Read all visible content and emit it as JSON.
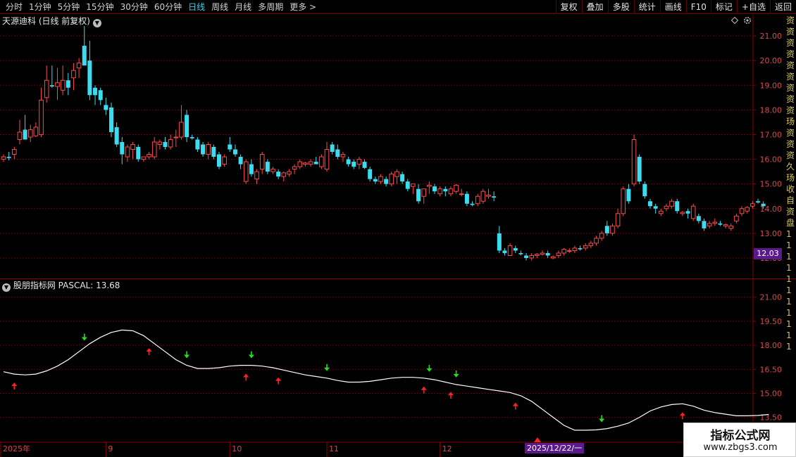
{
  "colors": {
    "up": "#ff4a4a",
    "down": "#3cdcf0",
    "grid": "#8a0000",
    "axis_text": "#d84a4a",
    "pascal_line": "#ffffff",
    "arrow_up": "#ff2020",
    "arrow_down": "#20e020",
    "date_tag_bg": "#5a1a8c"
  },
  "toolbar": {
    "periods": [
      {
        "label": "分时",
        "active": false
      },
      {
        "label": "1分钟",
        "active": false
      },
      {
        "label": "5分钟",
        "active": false
      },
      {
        "label": "15分钟",
        "active": false
      },
      {
        "label": "30分钟",
        "active": false
      },
      {
        "label": "60分钟",
        "active": false
      },
      {
        "label": "日线",
        "active": true
      },
      {
        "label": "周线",
        "active": false
      },
      {
        "label": "月线",
        "active": false
      },
      {
        "label": "多周期",
        "active": false
      },
      {
        "label": "更多 >",
        "active": false
      }
    ],
    "buttons": [
      "复权",
      "叠加",
      "多股",
      "统计",
      "画线",
      "F10",
      "标记",
      "+自选",
      "返回"
    ]
  },
  "main_chart": {
    "title": "天源迪科 (日线 前复权)",
    "price_tag": "12.03",
    "y_ticks": [
      "21.00",
      "20.00",
      "19.00",
      "18.00",
      "17.00",
      "16.00",
      "15.00",
      "14.00",
      "13.00",
      "12.00"
    ]
  },
  "sub_chart": {
    "title": "股朋指标网 PASCAL: 13.68",
    "y_ticks": [
      "21.00",
      "19.50",
      "18.00",
      "16.50",
      "15.00",
      "13.50"
    ]
  },
  "x_axis": {
    "labels": [
      "2025年",
      "9",
      "10",
      "11",
      "12"
    ],
    "date_tag": "2025/12/22/一"
  },
  "right_strip": [
    "资",
    "资",
    "资",
    "资",
    "资",
    "资",
    "资",
    "资",
    "资",
    "玚",
    "资",
    "资",
    "资",
    "久",
    "玚",
    "收",
    "自",
    "资",
    "盘",
    "1",
    "1",
    "1",
    "1",
    "1",
    "1",
    "1",
    "1",
    "1",
    "1",
    "1"
  ],
  "watermark": {
    "name": "指标公式网",
    "url": "www.zbgs3.com"
  },
  "chart_data": [
    {
      "type": "candlestick",
      "ylim": [
        11.6,
        21.6
      ],
      "candles": [
        [
          16.0,
          16.2,
          15.9,
          16.1
        ],
        [
          16.1,
          16.3,
          15.95,
          16.05
        ],
        [
          16.2,
          16.5,
          16.0,
          16.4
        ],
        [
          16.8,
          17.6,
          16.6,
          17.1
        ],
        [
          17.2,
          17.8,
          16.9,
          16.8
        ],
        [
          16.9,
          17.4,
          16.7,
          17.2
        ],
        [
          16.95,
          17.5,
          16.9,
          17.3
        ],
        [
          17.0,
          18.9,
          16.9,
          18.4
        ],
        [
          18.5,
          19.8,
          18.3,
          19.2
        ],
        [
          19.0,
          19.8,
          18.9,
          18.95
        ],
        [
          18.95,
          19.7,
          18.4,
          19.1
        ],
        [
          18.8,
          19.8,
          18.6,
          19.2
        ],
        [
          19.2,
          19.5,
          18.6,
          18.9
        ],
        [
          19.3,
          19.9,
          18.8,
          19.6
        ],
        [
          19.7,
          20.1,
          19.3,
          19.9
        ],
        [
          20.6,
          21.4,
          19.8,
          19.8
        ],
        [
          20.0,
          20.8,
          18.4,
          18.6
        ],
        [
          18.9,
          19.0,
          18.2,
          18.6
        ],
        [
          18.8,
          18.9,
          18.2,
          18.4
        ],
        [
          18.2,
          18.5,
          17.8,
          18.0
        ],
        [
          18.1,
          18.3,
          16.9,
          17.1
        ],
        [
          17.3,
          17.5,
          16.5,
          16.6
        ],
        [
          16.7,
          16.9,
          15.8,
          16.2
        ],
        [
          16.1,
          16.6,
          15.9,
          16.5
        ],
        [
          16.4,
          16.7,
          16.0,
          16.6
        ],
        [
          16.5,
          16.6,
          15.9,
          16.0
        ],
        [
          16.0,
          16.1,
          15.9,
          16.1
        ],
        [
          16.1,
          16.3,
          16.0,
          16.2
        ],
        [
          16.1,
          16.9,
          16.0,
          16.7
        ],
        [
          16.6,
          16.8,
          16.4,
          16.7
        ],
        [
          16.7,
          16.9,
          16.4,
          16.5
        ],
        [
          16.5,
          17.0,
          16.4,
          16.8
        ],
        [
          16.9,
          17.2,
          16.5,
          16.9
        ],
        [
          16.9,
          18.2,
          16.8,
          17.5
        ],
        [
          17.8,
          18.0,
          16.7,
          16.9
        ],
        [
          16.9,
          17.0,
          16.8,
          16.85
        ],
        [
          16.8,
          16.9,
          16.3,
          16.4
        ],
        [
          16.6,
          16.7,
          16.1,
          16.2
        ],
        [
          16.2,
          16.7,
          16.0,
          16.6
        ],
        [
          16.5,
          16.6,
          16.0,
          16.1
        ],
        [
          16.2,
          16.3,
          15.6,
          15.7
        ],
        [
          15.8,
          16.2,
          15.7,
          16.1
        ],
        [
          16.6,
          16.9,
          16.3,
          16.4
        ],
        [
          16.4,
          16.6,
          16.1,
          16.2
        ],
        [
          16.1,
          16.2,
          15.6,
          15.8
        ],
        [
          15.1,
          16.0,
          15.0,
          15.9
        ],
        [
          15.8,
          16.0,
          15.3,
          15.4
        ],
        [
          15.2,
          15.6,
          15.0,
          15.5
        ],
        [
          15.6,
          16.3,
          15.4,
          16.2
        ],
        [
          15.9,
          16.0,
          15.4,
          15.5
        ],
        [
          15.5,
          15.7,
          15.4,
          15.6
        ],
        [
          15.5,
          15.6,
          15.2,
          15.3
        ],
        [
          15.3,
          15.5,
          15.1,
          15.45
        ],
        [
          15.4,
          15.6,
          15.3,
          15.5
        ],
        [
          15.6,
          15.8,
          15.4,
          15.7
        ],
        [
          15.7,
          16.0,
          15.6,
          15.9
        ],
        [
          15.8,
          15.9,
          15.7,
          15.85
        ],
        [
          15.8,
          16.0,
          15.7,
          15.9
        ],
        [
          15.9,
          16.1,
          15.8,
          15.8
        ],
        [
          15.7,
          16.2,
          15.6,
          16.1
        ],
        [
          15.6,
          16.7,
          15.5,
          16.4
        ],
        [
          16.6,
          16.7,
          16.2,
          16.3
        ],
        [
          16.4,
          16.6,
          16.0,
          16.1
        ],
        [
          16.1,
          16.3,
          15.9,
          16.2
        ],
        [
          16.0,
          16.1,
          15.7,
          15.8
        ],
        [
          15.9,
          16.0,
          15.6,
          15.7
        ],
        [
          15.8,
          16.1,
          15.6,
          16.0
        ],
        [
          15.9,
          16.0,
          15.6,
          15.65
        ],
        [
          15.6,
          15.7,
          15.1,
          15.2
        ],
        [
          15.2,
          15.3,
          15.0,
          15.1
        ],
        [
          15.1,
          15.4,
          15.0,
          15.3
        ],
        [
          15.2,
          15.3,
          14.9,
          15.0
        ],
        [
          15.0,
          15.5,
          14.9,
          15.4
        ],
        [
          15.3,
          15.6,
          15.0,
          15.5
        ],
        [
          15.4,
          15.5,
          15.0,
          15.1
        ],
        [
          15.1,
          15.2,
          14.7,
          14.8
        ],
        [
          14.9,
          15.0,
          14.6,
          15.0
        ],
        [
          14.8,
          15.0,
          14.2,
          14.3
        ],
        [
          14.5,
          14.7,
          14.2,
          14.8
        ],
        [
          14.9,
          15.1,
          14.6,
          14.95
        ],
        [
          14.9,
          15.0,
          14.6,
          14.7
        ],
        [
          14.6,
          14.9,
          14.5,
          14.8
        ],
        [
          14.8,
          14.9,
          14.5,
          14.7
        ],
        [
          14.6,
          14.9,
          14.5,
          14.8
        ],
        [
          14.7,
          15.0,
          14.6,
          14.95
        ],
        [
          14.6,
          14.8,
          14.5,
          14.6
        ],
        [
          14.6,
          14.7,
          14.1,
          14.2
        ],
        [
          14.2,
          14.3,
          14.1,
          14.15
        ],
        [
          14.2,
          14.6,
          14.1,
          14.5
        ],
        [
          14.3,
          14.8,
          14.2,
          14.7
        ],
        [
          14.5,
          14.8,
          14.4,
          14.55
        ],
        [
          14.5,
          14.7,
          14.3,
          14.45
        ],
        [
          13.0,
          13.3,
          12.2,
          12.3
        ],
        [
          12.3,
          12.4,
          12.1,
          12.2
        ],
        [
          12.1,
          12.6,
          12.1,
          12.5
        ],
        [
          12.4,
          12.5,
          12.2,
          12.3
        ],
        [
          12.2,
          12.3,
          12.1,
          12.15
        ],
        [
          12.1,
          12.2,
          11.9,
          12.0
        ],
        [
          12.0,
          12.2,
          11.9,
          12.1
        ],
        [
          12.1,
          12.2,
          12.0,
          12.15
        ],
        [
          12.15,
          12.3,
          12.1,
          12.2
        ],
        [
          12.2,
          12.3,
          12.0,
          12.1
        ],
        [
          12.0,
          12.1,
          11.95,
          12.05
        ],
        [
          12.1,
          12.3,
          12.0,
          12.2
        ],
        [
          12.2,
          12.4,
          12.1,
          12.35
        ],
        [
          12.3,
          12.4,
          12.2,
          12.3
        ],
        [
          12.3,
          12.5,
          12.2,
          12.4
        ],
        [
          12.4,
          12.5,
          12.3,
          12.35
        ],
        [
          12.4,
          12.6,
          12.3,
          12.5
        ],
        [
          12.5,
          12.7,
          12.4,
          12.6
        ],
        [
          12.6,
          12.9,
          12.5,
          12.8
        ],
        [
          12.8,
          13.1,
          12.7,
          13.0
        ],
        [
          13.3,
          13.5,
          12.9,
          13.0
        ],
        [
          13.0,
          13.4,
          12.9,
          13.3
        ],
        [
          13.3,
          14.0,
          13.2,
          13.8
        ],
        [
          13.8,
          14.9,
          13.7,
          14.8
        ],
        [
          14.8,
          15.0,
          14.2,
          14.3
        ],
        [
          15.0,
          17.0,
          14.9,
          16.8
        ],
        [
          16.1,
          16.2,
          15.0,
          15.1
        ],
        [
          15.0,
          15.1,
          14.4,
          14.5
        ],
        [
          14.3,
          14.4,
          14.0,
          14.1
        ],
        [
          14.1,
          14.2,
          13.8,
          14.0
        ],
        [
          13.8,
          14.0,
          13.7,
          13.9
        ],
        [
          14.0,
          14.2,
          13.9,
          14.1
        ],
        [
          14.1,
          14.4,
          14.0,
          14.3
        ],
        [
          14.3,
          14.4,
          13.8,
          13.9
        ],
        [
          13.8,
          13.9,
          13.7,
          13.85
        ],
        [
          13.9,
          14.0,
          13.6,
          13.8
        ],
        [
          13.6,
          14.2,
          13.5,
          14.1
        ],
        [
          13.7,
          13.8,
          13.4,
          13.5
        ],
        [
          13.5,
          13.6,
          13.1,
          13.2
        ],
        [
          13.3,
          13.5,
          13.2,
          13.4
        ],
        [
          13.4,
          13.6,
          13.3,
          13.45
        ],
        [
          13.4,
          13.5,
          13.3,
          13.35
        ],
        [
          13.3,
          13.4,
          13.2,
          13.35
        ],
        [
          13.2,
          13.4,
          13.1,
          13.3
        ],
        [
          13.5,
          13.8,
          13.4,
          13.7
        ],
        [
          13.8,
          14.1,
          13.7,
          14.0
        ],
        [
          13.9,
          14.1,
          13.8,
          14.05
        ],
        [
          14.1,
          14.3,
          14.0,
          14.2
        ],
        [
          14.3,
          14.4,
          14.2,
          14.25
        ],
        [
          14.2,
          14.3,
          14.0,
          14.1
        ]
      ]
    },
    {
      "type": "line",
      "name": "PASCAL",
      "ylim": [
        12.3,
        21.6
      ],
      "values": [
        16.35,
        16.2,
        16.15,
        16.2,
        16.4,
        16.7,
        17.1,
        17.6,
        18.1,
        18.5,
        18.8,
        18.95,
        18.9,
        18.6,
        18.1,
        17.6,
        17.1,
        16.75,
        16.55,
        16.55,
        16.6,
        16.7,
        16.75,
        16.75,
        16.7,
        16.6,
        16.45,
        16.3,
        16.15,
        16.05,
        15.95,
        15.8,
        15.7,
        15.7,
        15.75,
        15.85,
        15.95,
        16.0,
        16.0,
        15.95,
        15.85,
        15.7,
        15.55,
        15.45,
        15.35,
        15.25,
        15.15,
        15.05,
        14.85,
        14.5,
        14.0,
        13.5,
        13.0,
        12.7,
        12.7,
        12.72,
        12.8,
        12.95,
        13.15,
        13.5,
        13.9,
        14.15,
        14.3,
        14.35,
        14.2,
        13.95,
        13.8,
        13.7,
        13.6,
        13.6,
        13.62,
        13.68
      ],
      "signals": [
        {
          "type": "buy",
          "bar": 2
        },
        {
          "type": "sell",
          "bar": 15
        },
        {
          "type": "buy",
          "bar": 27
        },
        {
          "type": "sell",
          "bar": 34
        },
        {
          "type": "buy",
          "bar": 45
        },
        {
          "type": "sell",
          "bar": 46
        },
        {
          "type": "buy",
          "bar": 51
        },
        {
          "type": "sell",
          "bar": 60
        },
        {
          "type": "buy",
          "bar": 78
        },
        {
          "type": "sell",
          "bar": 79
        },
        {
          "type": "buy",
          "bar": 83
        },
        {
          "type": "sell",
          "bar": 84
        },
        {
          "type": "buy",
          "bar": 95
        },
        {
          "type": "sell",
          "bar": 111
        },
        {
          "type": "buy",
          "bar": 126
        }
      ]
    }
  ]
}
